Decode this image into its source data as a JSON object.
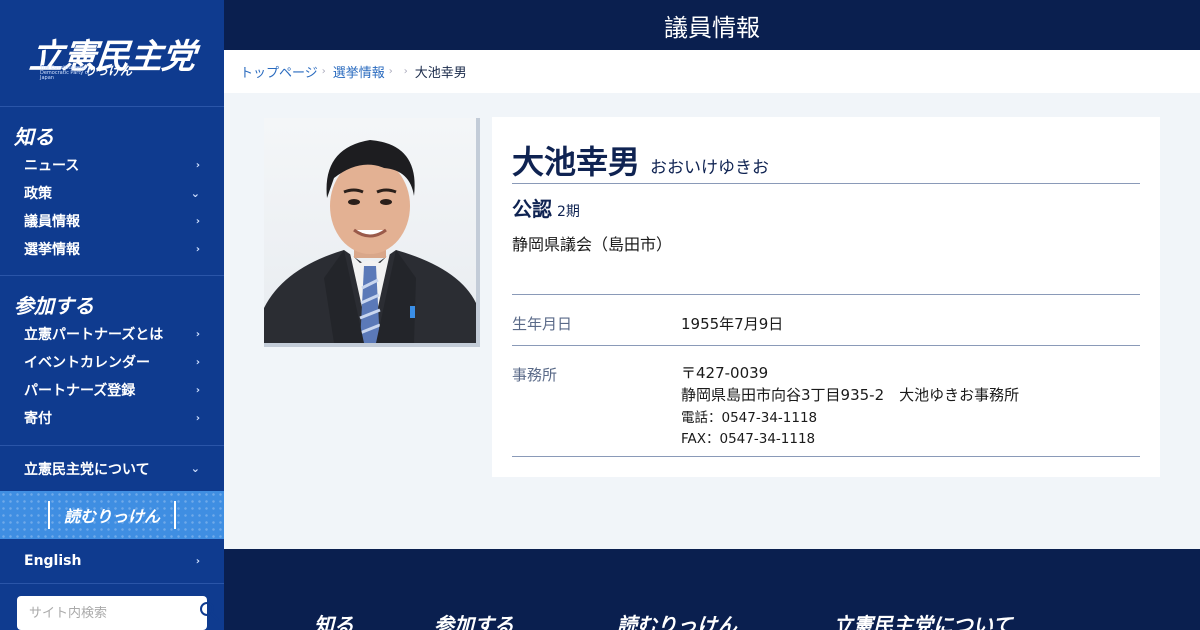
{
  "sidebar": {
    "logo_text": "立憲民主党",
    "logo_sub": "りっけん",
    "logo_en": "The Constitutional Democratic Party of Japan",
    "section_know": "知る",
    "know_items": [
      {
        "label": "ニュース",
        "chevron": "›"
      },
      {
        "label": "政策",
        "chevron": "⌄"
      },
      {
        "label": "議員情報",
        "chevron": "›"
      },
      {
        "label": "選挙情報",
        "chevron": "›"
      }
    ],
    "section_join": "参加する",
    "join_items": [
      {
        "label": "立憲パートナーズとは",
        "chevron": "›"
      },
      {
        "label": "イベントカレンダー",
        "chevron": "›"
      },
      {
        "label": "パートナーズ登録",
        "chevron": "›"
      },
      {
        "label": "寄付",
        "chevron": "›"
      }
    ],
    "about": {
      "label": "立憲民主党について",
      "chevron": "⌄"
    },
    "yomu_banner": "読むりっけん",
    "english": {
      "label": "English",
      "chevron": "›"
    },
    "search_placeholder": "サイト内検索"
  },
  "header": {
    "title": "議員情報"
  },
  "breadcrumb": [
    {
      "label": "トップページ"
    },
    {
      "label": "選挙情報"
    },
    {
      "label": ""
    },
    {
      "label": "大池幸男"
    }
  ],
  "breadcrumb_sep": "›",
  "profile": {
    "name": "大池幸男",
    "kana": "おおいけゆきお",
    "endorsement": "公認",
    "term": "2期",
    "assembly": "静岡県議会（島田市）",
    "birth_label": "生年月日",
    "birth_value": "1955年7月9日",
    "office_label": "事務所",
    "office_zip": "〒427-0039",
    "office_address": "静岡県島田市向谷3丁目935-2　大池ゆきお事務所",
    "office_tel": "電話：0547-34-1118",
    "office_fax": "FAX：0547-34-1118"
  },
  "footer": {
    "items": [
      "知る",
      "参加する",
      "読むりっけん",
      "立憲民主党について"
    ]
  },
  "colors": {
    "sidebar_bg": "#0f3b8f",
    "header_bg": "#0a1f4f",
    "accent_blue": "#3f8ee2",
    "name_color": "#0f2352"
  }
}
